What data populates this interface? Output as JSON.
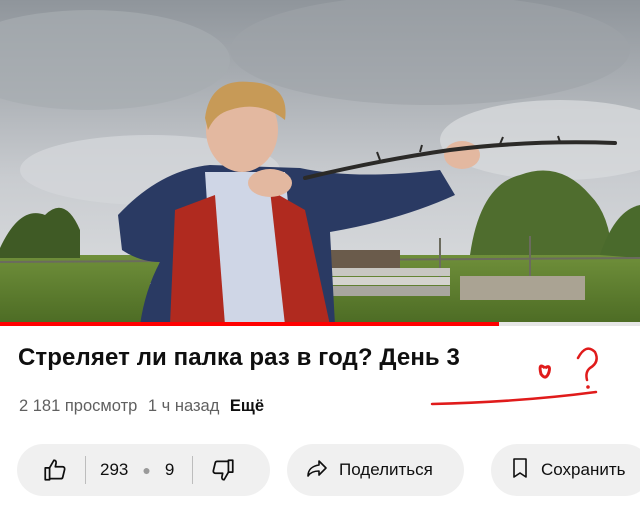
{
  "video": {
    "title": "Стреляет ли палка раз в год? День 3",
    "views": "2 181 просмотр",
    "age": "1 ч назад",
    "more_label": "Ещё",
    "progress_fraction": 0.78,
    "colors": {
      "progress": "#ff0000",
      "accent_scribble": "#e01b1b"
    }
  },
  "actions": {
    "like_icon": "thumb-up-icon",
    "like_count": "293",
    "dislike_count": "9",
    "dislike_icon": "thumb-down-icon",
    "share_icon": "share-arrow-icon",
    "share_label": "Поделиться",
    "save_icon": "bookmark-icon",
    "save_label": "Сохранить"
  }
}
